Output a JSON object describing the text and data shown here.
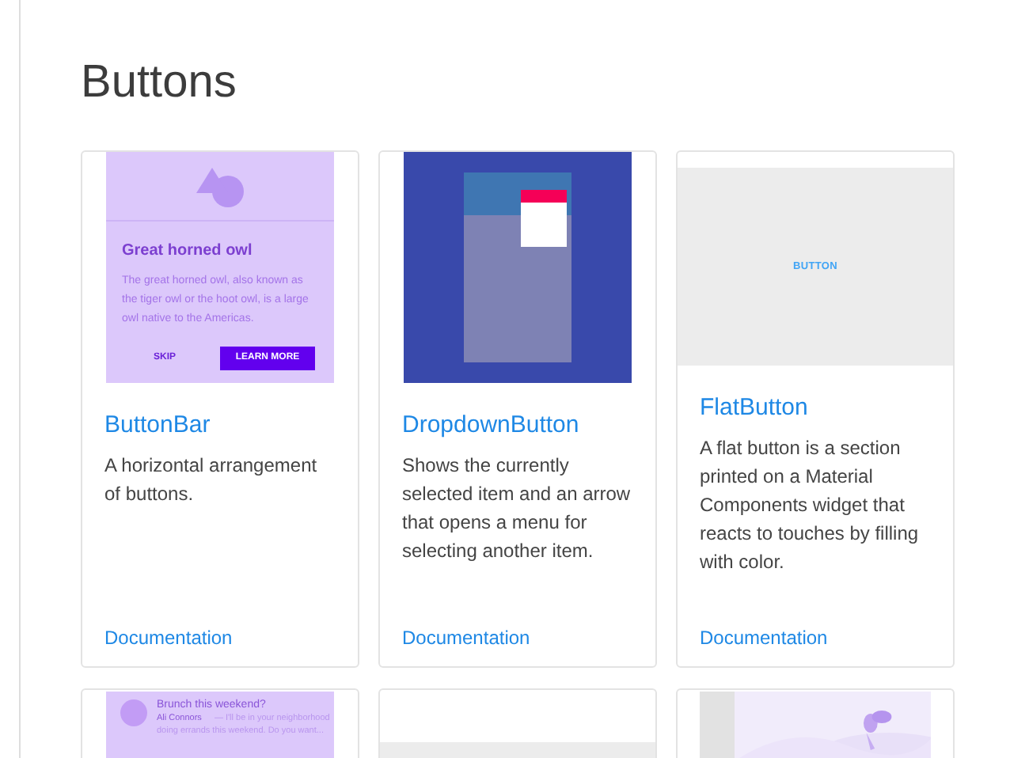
{
  "heading": "Buttons",
  "cards": [
    {
      "kind": "button_bar",
      "preview": {
        "title": "Great horned owl",
        "body": "The great horned owl, also known as the tiger owl or the hoot owl, is a large owl native to the Americas.",
        "actions": [
          "SKIP",
          "LEARN MORE"
        ]
      },
      "title": "ButtonBar",
      "description": "A horizontal arrangement of buttons.",
      "link": "Documentation"
    },
    {
      "kind": "dropdown",
      "title": "DropdownButton",
      "description": "Shows the currently selected item and an arrow that opens a menu for selecting another item.",
      "link": "Documentation"
    },
    {
      "kind": "flat",
      "preview": {
        "button": "BUTTON"
      },
      "title": "FlatButton",
      "description": "A flat button is a section printed on a Material Components widget that reacts to touches by filling with color.",
      "link": "Documentation"
    }
  ],
  "second_row": [
    {
      "kind": "list",
      "preview": {
        "title": "Brunch this weekend?",
        "sender": "Ali Connors",
        "snippet": "— I'll be in your neighborhood",
        "snippet_2": "doing errands this weekend. Do you want..."
      }
    },
    {
      "kind": "blank"
    },
    {
      "kind": "picture"
    }
  ]
}
